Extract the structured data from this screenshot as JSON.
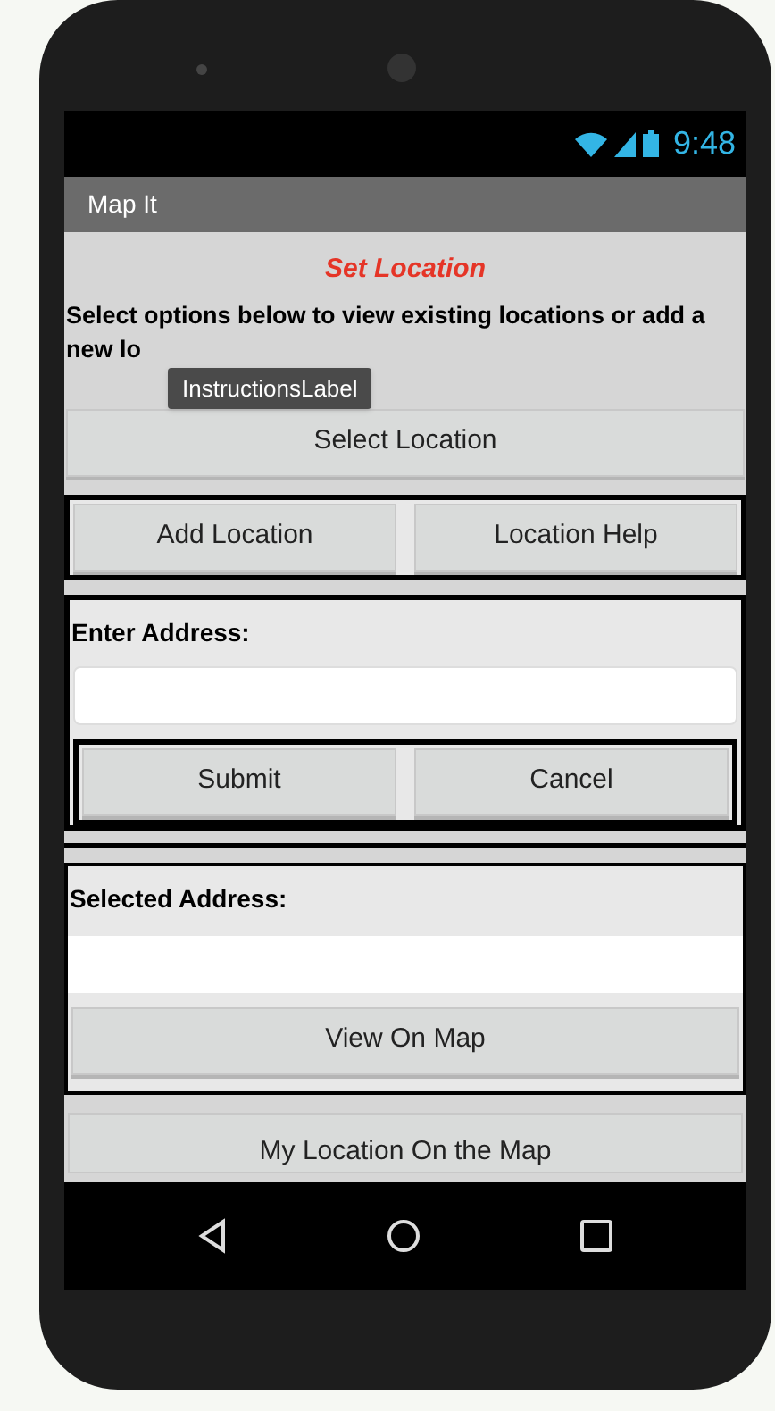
{
  "status_bar": {
    "time": "9:48"
  },
  "app_bar": {
    "title": "Map It"
  },
  "heading": "Set Location",
  "instructions": "Select options below to view existing locations or add a new lo",
  "tooltip": "InstructionsLabel",
  "select_button": "Select Location",
  "location_buttons": [
    "Add Location",
    "Location Help"
  ],
  "address_form": {
    "label": "Enter Address:",
    "buttons": [
      "Submit",
      "Cancel"
    ]
  },
  "selected_address": {
    "label": "Selected Address:",
    "button": "View On Map"
  },
  "bottom_button": "My Location On the Map"
}
